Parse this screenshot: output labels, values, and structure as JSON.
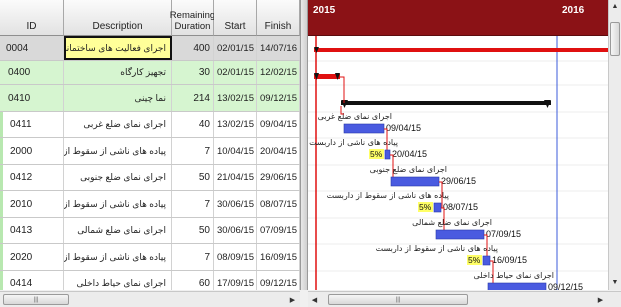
{
  "table": {
    "columns": {
      "id": "ID",
      "description": "Description",
      "duration": "Remaining\nDuration",
      "start": "Start",
      "finish": "Finish"
    },
    "rows": [
      {
        "id": "0004",
        "description": "اجرای فعالیت های ساختمانی",
        "duration": "400",
        "start": "02/01/15",
        "finish": "14/07/16",
        "level": 0
      },
      {
        "id": "0400",
        "description": "تجهیز کارگاه",
        "duration": "30",
        "start": "02/01/15",
        "finish": "12/02/15",
        "level": 1
      },
      {
        "id": "0410",
        "description": "نما چینی",
        "duration": "214",
        "start": "13/02/15",
        "finish": "09/12/15",
        "level": 1
      },
      {
        "id": "0411",
        "description": "اجرای نمای ضلع غربی",
        "duration": "40",
        "start": "13/02/15",
        "finish": "09/04/15",
        "level": 2
      },
      {
        "id": "2000",
        "description": "پیاده های ناشی از سقوط از داربست",
        "duration": "7",
        "start": "10/04/15",
        "finish": "20/04/15",
        "level": 2
      },
      {
        "id": "0412",
        "description": "اجرای نمای ضلع جنوبی",
        "duration": "50",
        "start": "21/04/15",
        "finish": "29/06/15",
        "level": 2
      },
      {
        "id": "2010",
        "description": "پیاده های ناشی از سقوط از داربست",
        "duration": "7",
        "start": "30/06/15",
        "finish": "08/07/15",
        "level": 2
      },
      {
        "id": "0413",
        "description": "اجرای نمای ضلع شمالی",
        "duration": "50",
        "start": "30/06/15",
        "finish": "07/09/15",
        "level": 2
      },
      {
        "id": "2020",
        "description": "پیاده های ناشی از سقوط از داربست",
        "duration": "7",
        "start": "08/09/15",
        "finish": "16/09/15",
        "level": 2
      },
      {
        "id": "0414",
        "description": "اجرای نمای حیاط داخلی",
        "duration": "60",
        "start": "17/09/15",
        "finish": "09/12/15",
        "level": 2
      }
    ]
  },
  "gantt": {
    "years": [
      "2015",
      "2016"
    ],
    "header_color": "#8b1216",
    "activities": [
      {
        "row": 3,
        "label": "اجرای نمای ضلع غربی",
        "date": "09/04/15"
      },
      {
        "row": 4,
        "label": "پیاده های ناشی از داربست",
        "date": "20/04/15",
        "percent": "5%"
      },
      {
        "row": 5,
        "label": "اجرای نمای ضلع جنوبی",
        "date": "29/06/15"
      },
      {
        "row": 6,
        "label": "پیاده های ناشی از سقوط از داربست",
        "date": "08/07/15",
        "percent": "5%"
      },
      {
        "row": 7,
        "label": "اجرای نمای ضلع شمالی",
        "date": "07/09/15"
      },
      {
        "row": 8,
        "label": "پیاده های ناشی از سقوط از داربست",
        "date": "16/09/15",
        "percent": "5%"
      },
      {
        "row": 9,
        "label": "اجرای نمای حیاط داخلی",
        "date": "09/12/15"
      }
    ],
    "colors": {
      "critical": "#e01010",
      "activity_bar": "#4a5be0",
      "summary": "#111111",
      "data_date": "#e01010",
      "year_line": "#3b5bdb",
      "percent_badge": "#ffff66"
    }
  },
  "icons": {
    "scroll_up": "up-arrow-icon",
    "scroll_down": "down-arrow-icon",
    "scroll_left": "left-arrow-icon",
    "scroll_right": "right-arrow-icon"
  }
}
